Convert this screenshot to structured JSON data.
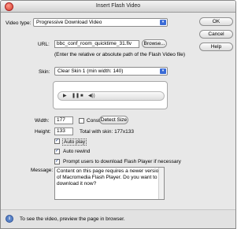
{
  "window": {
    "title": "Insert Flash Video"
  },
  "video_type": {
    "label": "Video type:",
    "value": "Progressive Download Video"
  },
  "url": {
    "label": "URL:",
    "value": "bbc_conf_room_quicktime_31.flv",
    "browse": "Browse...",
    "hint": "(Enter the relative or absolute path of the Flash Video file)"
  },
  "skin": {
    "label": "Skin:",
    "value": "Clear Skin 1 (min width: 140)"
  },
  "width": {
    "label": "Width:",
    "value": "177",
    "constrain": "Constrain",
    "detect": "Detect Size"
  },
  "height": {
    "label": "Height:",
    "value": "133",
    "total": "Total with skin: 177x133"
  },
  "options": {
    "autoplay": "Auto play",
    "autorewind": "Auto rewind",
    "prompt": "Prompt users to download Flash Player if necessary"
  },
  "message": {
    "label": "Message:",
    "value": "Content on this page requires a newer version of Macromedia Flash Player. Do you want to download it now?"
  },
  "buttons": {
    "ok": "OK",
    "cancel": "Cancel",
    "help": "Help"
  },
  "info": {
    "text": "To see the video, preview the page in browser."
  }
}
